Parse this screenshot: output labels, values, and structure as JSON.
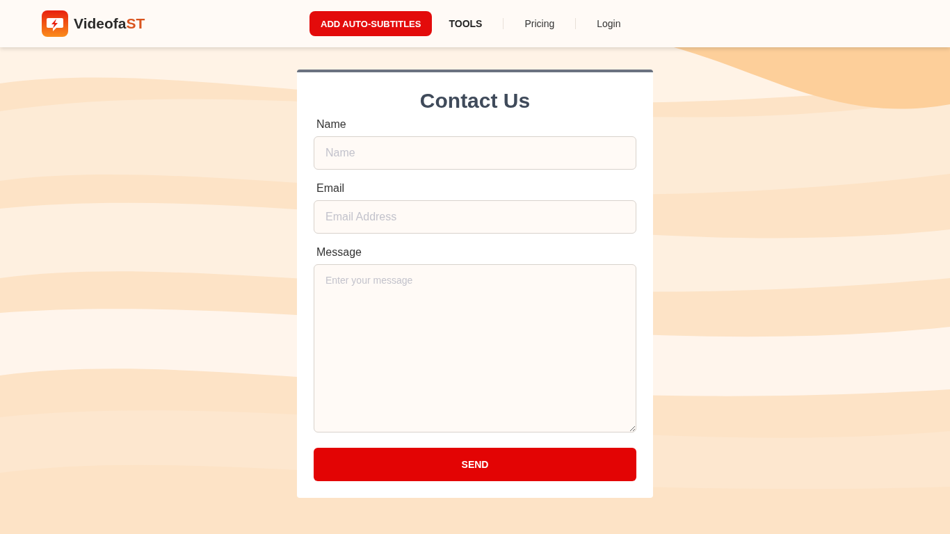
{
  "header": {
    "logo": {
      "text": "Videofa",
      "accent": "ST"
    },
    "nav": [
      {
        "label": "ADD AUTO-SUBTITLES",
        "kind": "button"
      },
      {
        "label": "TOOLS",
        "kind": "menu"
      },
      {
        "label": "Pricing",
        "kind": "link"
      },
      {
        "label": "Login",
        "kind": "link"
      }
    ]
  },
  "form": {
    "title": "Contact Us",
    "fields": [
      {
        "label": "Name",
        "placeholder": "Name",
        "kind": "input"
      },
      {
        "label": "Email",
        "placeholder": "Email Address",
        "kind": "input"
      },
      {
        "label": "Message",
        "placeholder": "Enter your message",
        "kind": "textarea"
      }
    ],
    "submit": "SEND"
  }
}
